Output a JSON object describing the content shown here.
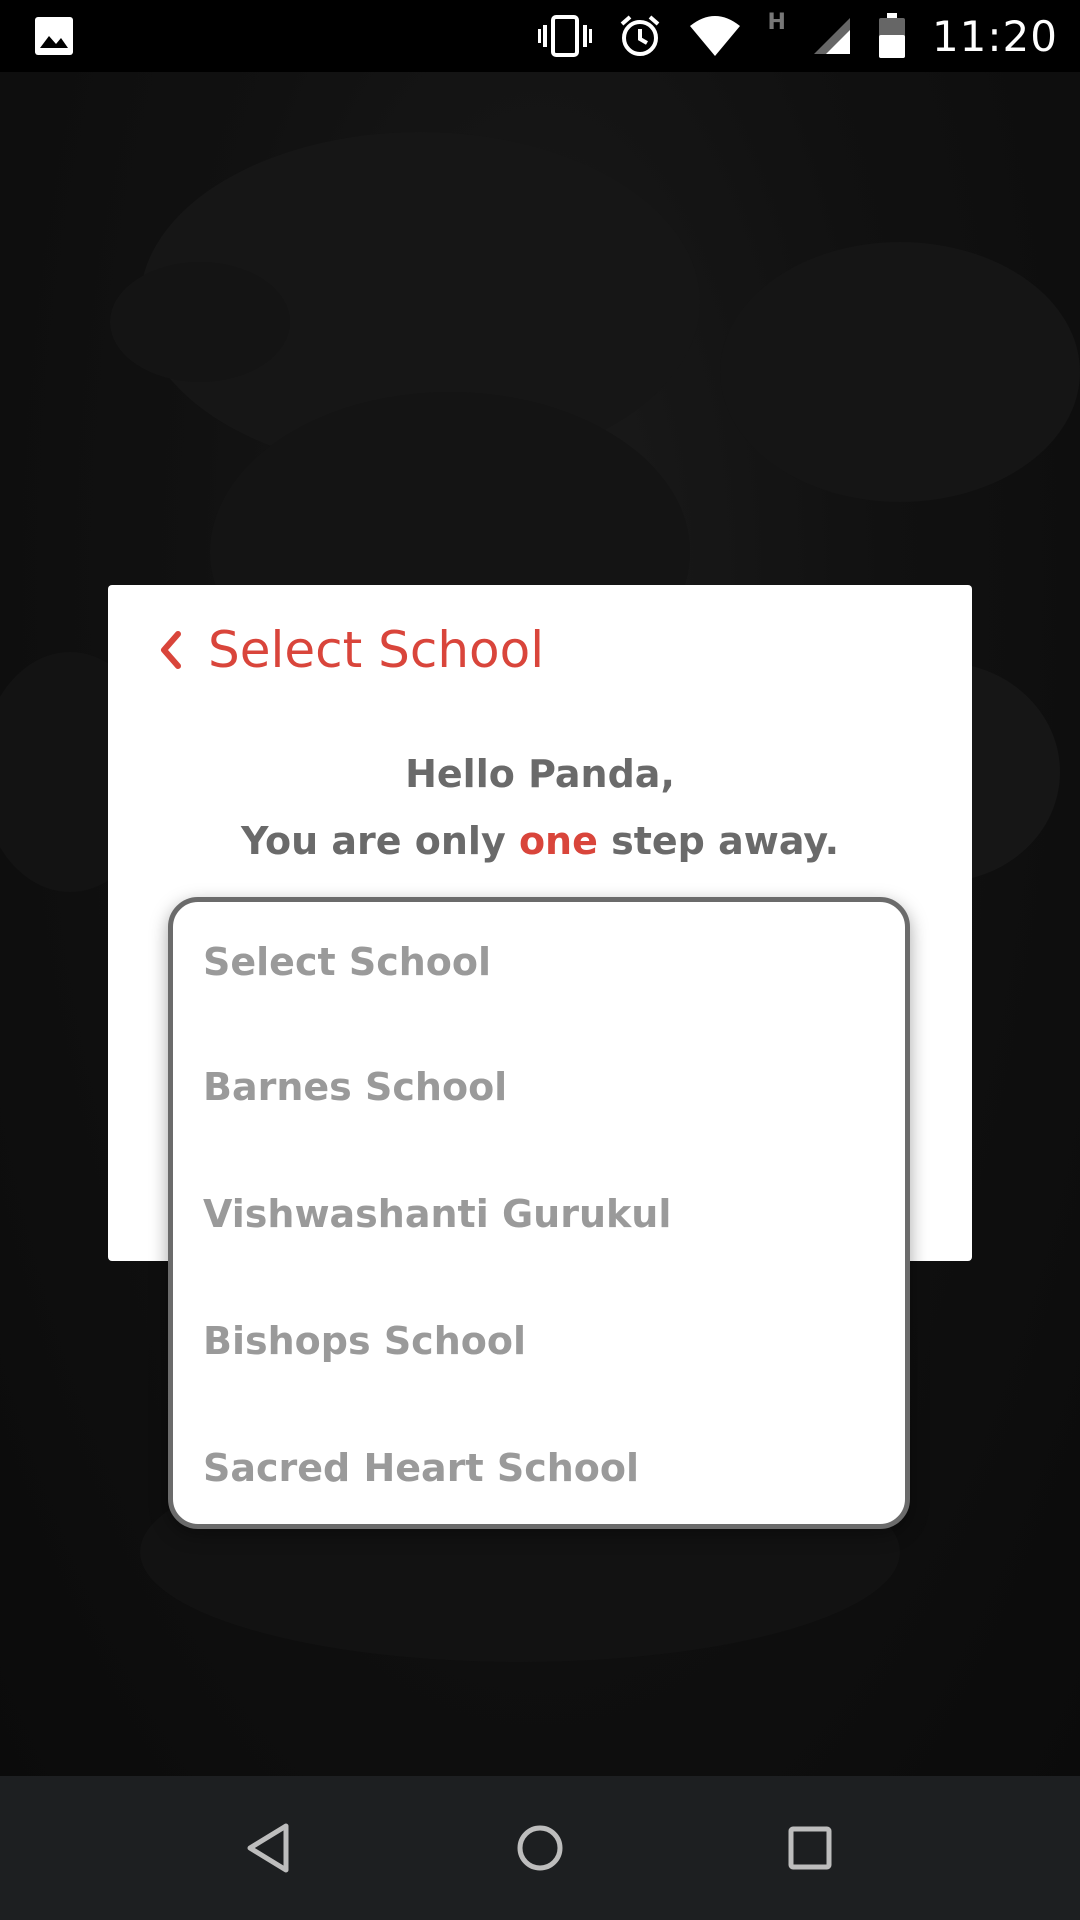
{
  "status_bar": {
    "time": "11:20",
    "network_type": "H",
    "icons": [
      "image-icon",
      "vibrate-icon",
      "alarm-icon",
      "wifi-icon",
      "cell-signal-icon",
      "battery-icon"
    ]
  },
  "dialog": {
    "title": "Select School",
    "greeting_line1": "Hello Panda,",
    "greeting_line2_before": "You are only ",
    "greeting_line2_accent": "one",
    "greeting_line2_after": " step away.",
    "accent_color": "#d9453b"
  },
  "dropdown": {
    "options": [
      "Select School",
      "Barnes School",
      "Vishwashanti Gurukul",
      "Bishops School",
      "Sacred Heart School"
    ]
  },
  "nav_bar": {
    "icons": [
      "back-icon",
      "home-icon",
      "recents-icon"
    ]
  }
}
